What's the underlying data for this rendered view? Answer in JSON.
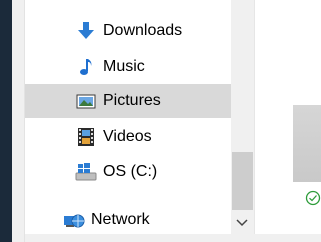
{
  "nav": {
    "items": [
      {
        "label": "Downloads",
        "icon": "download-arrow-icon"
      },
      {
        "label": "Music",
        "icon": "music-note-icon"
      },
      {
        "label": "Pictures",
        "icon": "pictures-icon",
        "selected": true
      },
      {
        "label": "Videos",
        "icon": "videos-film-icon"
      },
      {
        "label": "OS (C:)",
        "icon": "windows-drive-icon"
      },
      {
        "label": "Network",
        "icon": "network-globe-icon"
      }
    ]
  },
  "colors": {
    "accent_blue": "#2b7cd3",
    "selection_bg": "#d9d9d9",
    "check_green": "#2e9c3b"
  }
}
